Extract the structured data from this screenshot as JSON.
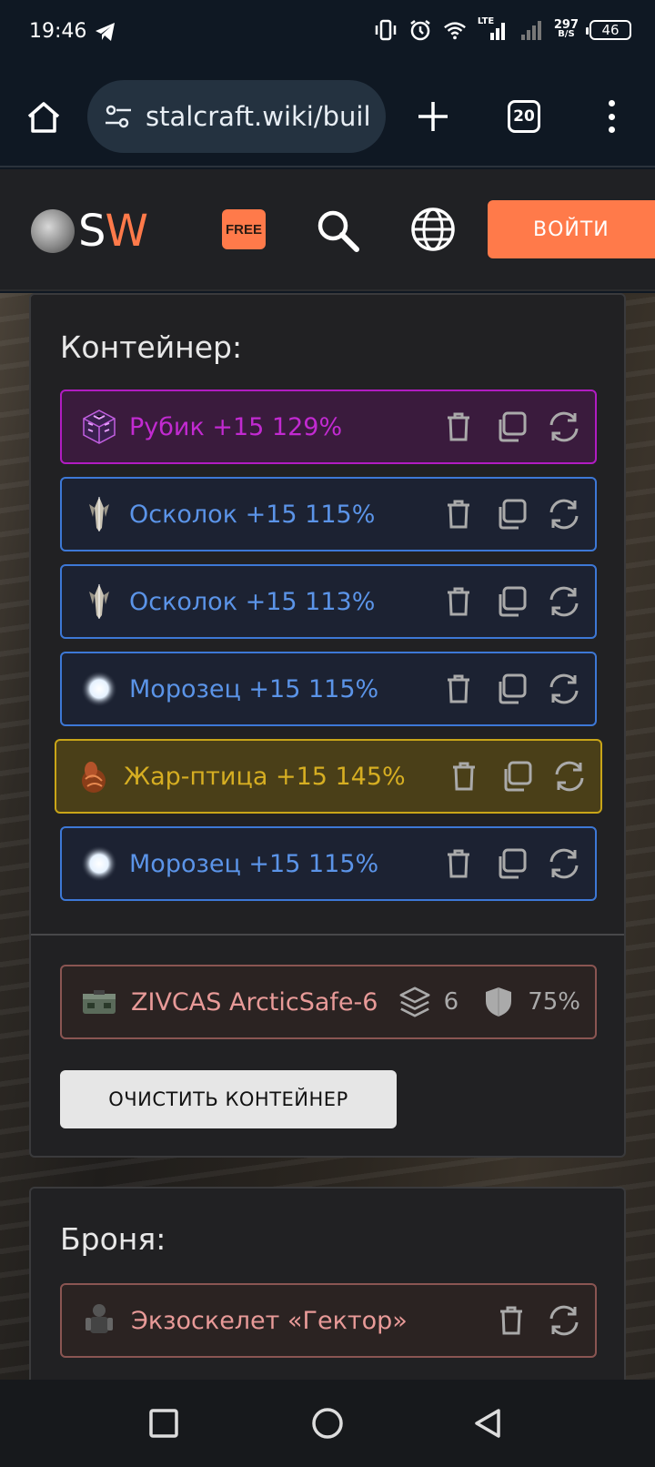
{
  "status": {
    "time": "19:46",
    "net_top": "297",
    "net_bottom": "B/S",
    "battery": "46",
    "lte": "LTE"
  },
  "browser": {
    "url": "stalcraft.wiki/buil",
    "tab_count": "20"
  },
  "site": {
    "logo_s": "S",
    "logo_w": "W",
    "free_badge": "FREE",
    "login": "ВОЙТИ"
  },
  "container_panel": {
    "title": "Контейнер:",
    "artifacts": [
      {
        "name": "Рубик +15 129%",
        "rarity": "purple",
        "icon": "cube-artifact-icon"
      },
      {
        "name": "Осколок +15 115%",
        "rarity": "blue",
        "icon": "crystal-artifact-icon"
      },
      {
        "name": "Осколок +15 113%",
        "rarity": "blue",
        "icon": "crystal-artifact-icon"
      },
      {
        "name": "Морозец +15 115%",
        "rarity": "blue",
        "icon": "frost-artifact-icon"
      },
      {
        "name": "Жар-птица +15 145%",
        "rarity": "gold",
        "icon": "firebird-artifact-icon"
      },
      {
        "name": "Морозец +15 115%",
        "rarity": "blue",
        "icon": "frost-artifact-icon"
      }
    ],
    "container": {
      "name": "ZIVCAS ArcticSafe-6",
      "slots": "6",
      "protection": "75%"
    },
    "clear_button": "ОЧИСТИТЬ КОНТЕЙНЕР"
  },
  "armor_panel": {
    "title": "Броня:",
    "item": {
      "name": "Экзоскелет «Гектор»"
    }
  },
  "colors": {
    "accent": "#ff7a4a",
    "purple": "#b11cc2",
    "blue": "#3d78d6",
    "gold": "#c9a518"
  }
}
